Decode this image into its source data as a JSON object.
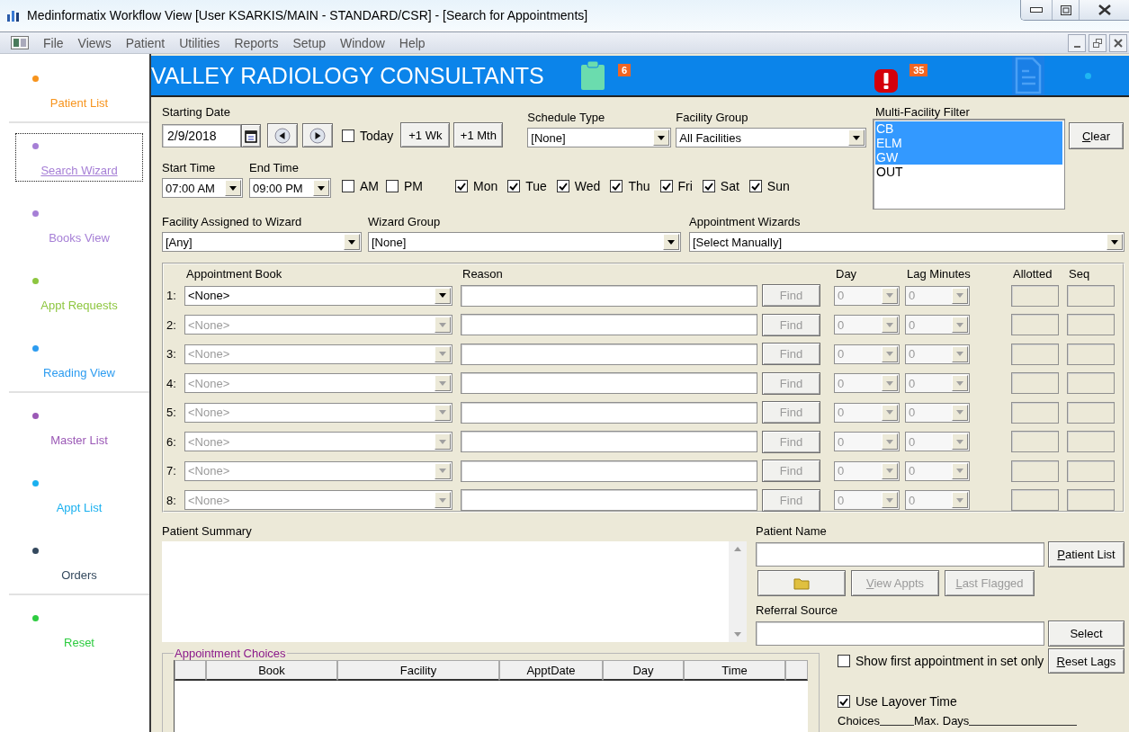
{
  "window": {
    "title": "Medinformatix Workflow View [User KSARKIS/MAIN - STANDARD/CSR] - [Search for Appointments]"
  },
  "menu": [
    "File",
    "Views",
    "Patient",
    "Utilities",
    "Reports",
    "Setup",
    "Window",
    "Help"
  ],
  "sidebar": {
    "items": [
      {
        "label": "Patient List",
        "color": "#f7941d",
        "selected": false,
        "separator_after": true
      },
      {
        "label": "Search Wizard",
        "color": "#a67fd6",
        "selected": true,
        "separator_after": false
      },
      {
        "label": "Books View",
        "color": "#a67fd6",
        "selected": false,
        "separator_after": false
      },
      {
        "label": "Appt Requests",
        "color": "#8dc63f",
        "selected": false,
        "separator_after": false
      },
      {
        "label": "Reading View",
        "color": "#2d9cf0",
        "selected": false,
        "separator_after": true
      },
      {
        "label": "Master List",
        "color": "#9b59b6",
        "selected": false,
        "separator_after": false
      },
      {
        "label": "Appt List",
        "color": "#1ab0ef",
        "selected": false,
        "separator_after": false
      },
      {
        "label": "Orders",
        "color": "#34495e",
        "selected": false,
        "separator_after": true
      },
      {
        "label": "Reset",
        "color": "#2ecc40",
        "selected": false,
        "separator_after": false
      }
    ]
  },
  "header": {
    "title": "VALLEY RADIOLOGY CONSULTANTS",
    "badges": [
      {
        "kind": "clipboard",
        "count": "6"
      },
      {
        "kind": "alert",
        "count": "35"
      }
    ]
  },
  "search": {
    "starting_date": {
      "label": "Starting Date",
      "value": "2/9/2018"
    },
    "today": {
      "label": "Today",
      "checked": false
    },
    "jump_buttons": [
      "+1 Wk",
      "+1 Mth"
    ],
    "schedule_type": {
      "label": "Schedule Type",
      "value": "[None]"
    },
    "facility_group": {
      "label": "Facility Group",
      "value": "All Facilities"
    },
    "multi_facility_filter": {
      "label": "Multi-Facility Filter",
      "items": [
        {
          "label": "CB",
          "selected": true
        },
        {
          "label": "ELM",
          "selected": true
        },
        {
          "label": "GW",
          "selected": true
        },
        {
          "label": "OUT",
          "selected": false
        }
      ]
    },
    "clear_button": {
      "label": "Clear",
      "mnemonic": true
    },
    "start_time": {
      "label": "Start Time",
      "value": "07:00 AM"
    },
    "end_time": {
      "label": "End Time",
      "value": "09:00 PM"
    },
    "period_filters": [
      {
        "label": "AM",
        "checked": false
      },
      {
        "label": "PM",
        "checked": false
      }
    ],
    "days": [
      {
        "label": "Mon",
        "checked": true
      },
      {
        "label": "Tue",
        "checked": true
      },
      {
        "label": "Wed",
        "checked": true
      },
      {
        "label": "Thu",
        "checked": true
      },
      {
        "label": "Fri",
        "checked": true
      },
      {
        "label": "Sat",
        "checked": true
      },
      {
        "label": "Sun",
        "checked": true
      }
    ],
    "facility_assigned": {
      "label": "Facility Assigned to Wizard",
      "value": "[Any]"
    },
    "wizard_group": {
      "label": "Wizard Group",
      "value": "[None]"
    },
    "appointment_wizards": {
      "label": "Appointment Wizards",
      "value": "[Select Manually]"
    }
  },
  "appointment_books": {
    "columns": [
      "Appointment Book",
      "Reason",
      "Day",
      "Lag Minutes",
      "Allotted",
      "Seq"
    ],
    "rows": [
      {
        "number": "1:",
        "book": "<None>",
        "book_disabled": false,
        "find": "Find",
        "find_disabled": true,
        "day": "0",
        "lag": "0"
      },
      {
        "number": "2:",
        "book": "<None>",
        "book_disabled": true,
        "find": "Find",
        "find_disabled": true,
        "day": "0",
        "lag": "0"
      },
      {
        "number": "3:",
        "book": "<None>",
        "book_disabled": true,
        "find": "Find",
        "find_disabled": true,
        "day": "0",
        "lag": "0"
      },
      {
        "number": "4:",
        "book": "<None>",
        "book_disabled": true,
        "find": "Find",
        "find_disabled": true,
        "day": "0",
        "lag": "0"
      },
      {
        "number": "5:",
        "book": "<None>",
        "book_disabled": true,
        "find": "Find",
        "find_disabled": true,
        "day": "0",
        "lag": "0"
      },
      {
        "number": "6:",
        "book": "<None>",
        "book_disabled": true,
        "find": "Find",
        "find_disabled": true,
        "day": "0",
        "lag": "0"
      },
      {
        "number": "7:",
        "book": "<None>",
        "book_disabled": true,
        "find": "Find",
        "find_disabled": true,
        "day": "0",
        "lag": "0"
      },
      {
        "number": "8:",
        "book": "<None>",
        "book_disabled": true,
        "find": "Find",
        "find_disabled": true,
        "day": "0",
        "lag": "0"
      }
    ]
  },
  "patient": {
    "summary_label": "Patient Summary",
    "name_label": "Patient Name",
    "patient_list_button": {
      "label": "Patient List",
      "mnemonic": true
    },
    "actions": [
      {
        "kind": "folder",
        "disabled": true
      },
      {
        "kind": "text",
        "label": "View Appts",
        "mnemonic": true,
        "disabled": true
      },
      {
        "kind": "text",
        "label": "Last Flagged",
        "mnemonic": true,
        "disabled": true
      }
    ],
    "referral_label": "Referral Source",
    "select_button": {
      "label": "Select",
      "mnemonic": false
    }
  },
  "appointment_choices": {
    "title": "Appointment Choices",
    "columns": [
      "Book",
      "Facility",
      "ApptDate",
      "Day",
      "Time"
    ]
  },
  "options": {
    "show_first": {
      "label": "Show first appointment in set only",
      "checked": false
    },
    "reset_lags_button": {
      "label": "Reset Lags",
      "mnemonic": true
    },
    "use_layover": {
      "label": "Use Layover Time",
      "checked": true
    },
    "footer_labels": [
      "Choices",
      "Max. Days"
    ]
  }
}
